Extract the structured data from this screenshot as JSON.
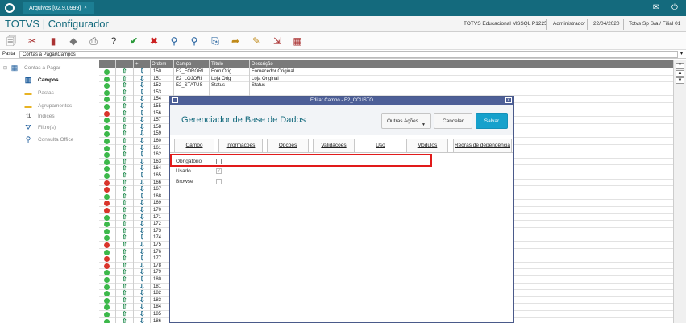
{
  "top_tab": "Arquivos [02.9.0999]",
  "app_title": "TOTVS | Configurador",
  "header_meta": {
    "env": "TOTVS Educacional MSSQL P1225",
    "user": "Administrador",
    "date": "22/04/2020",
    "branch": "Totvs Sp S/a / Filial 01"
  },
  "path": {
    "label": "Pasta",
    "value": "Contas a Pagar\\Campos"
  },
  "tree": {
    "root": "Contas a Pagar",
    "items": [
      "Campos",
      "Pastas",
      "Agrupamentos",
      "Índices",
      "Filtro(s)",
      "Consulta Office"
    ]
  },
  "grid": {
    "headers": [
      "-",
      "+",
      "Ordem",
      "Campo",
      "Título",
      "Descrição"
    ],
    "rows": [
      {
        "status": "green",
        "ordem": "150",
        "campo": "E2_FORORI",
        "titulo": "Forn.Orig.",
        "descricao": "Fornecedor Original"
      },
      {
        "status": "green",
        "ordem": "151",
        "campo": "E2_LOJORI",
        "titulo": "Loja Orig",
        "descricao": "Loja Original"
      },
      {
        "status": "green",
        "ordem": "152",
        "campo": "E2_STATUS",
        "titulo": "Status",
        "descricao": "Status"
      },
      {
        "status": "green",
        "ordem": "153",
        "campo": "",
        "titulo": "",
        "descricao": ""
      },
      {
        "status": "green",
        "ordem": "154",
        "campo": "",
        "titulo": "",
        "descricao": ""
      },
      {
        "status": "green",
        "ordem": "155",
        "campo": "",
        "titulo": "",
        "descricao": ""
      },
      {
        "status": "red",
        "ordem": "156",
        "campo": "",
        "titulo": "",
        "descricao": ""
      },
      {
        "status": "green",
        "ordem": "157",
        "campo": "",
        "titulo": "",
        "descricao": ""
      },
      {
        "status": "green",
        "ordem": "158",
        "campo": "",
        "titulo": "",
        "descricao": ""
      },
      {
        "status": "green",
        "ordem": "159",
        "campo": "",
        "titulo": "",
        "descricao": ""
      },
      {
        "status": "green",
        "ordem": "160",
        "campo": "",
        "titulo": "",
        "descricao": ""
      },
      {
        "status": "green",
        "ordem": "161",
        "campo": "",
        "titulo": "",
        "descricao": ""
      },
      {
        "status": "green",
        "ordem": "162",
        "campo": "",
        "titulo": "",
        "descricao": ""
      },
      {
        "status": "green",
        "ordem": "163",
        "campo": "",
        "titulo": "",
        "descricao": ""
      },
      {
        "status": "green",
        "ordem": "164",
        "campo": "",
        "titulo": "",
        "descricao": ""
      },
      {
        "status": "green",
        "ordem": "165",
        "campo": "",
        "titulo": "",
        "descricao": ""
      },
      {
        "status": "red",
        "ordem": "166",
        "campo": "",
        "titulo": "",
        "descricao": ""
      },
      {
        "status": "red",
        "ordem": "167",
        "campo": "",
        "titulo": "",
        "descricao": ""
      },
      {
        "status": "green",
        "ordem": "168",
        "campo": "",
        "titulo": "",
        "descricao": ""
      },
      {
        "status": "red",
        "ordem": "169",
        "campo": "",
        "titulo": "",
        "descricao": ""
      },
      {
        "status": "red",
        "ordem": "170",
        "campo": "",
        "titulo": "",
        "descricao": ""
      },
      {
        "status": "green",
        "ordem": "171",
        "campo": "",
        "titulo": "",
        "descricao": ""
      },
      {
        "status": "green",
        "ordem": "172",
        "campo": "",
        "titulo": "",
        "descricao": ""
      },
      {
        "status": "green",
        "ordem": "173",
        "campo": "",
        "titulo": "",
        "descricao": ""
      },
      {
        "status": "green",
        "ordem": "174",
        "campo": "",
        "titulo": "",
        "descricao": ""
      },
      {
        "status": "red",
        "ordem": "175",
        "campo": "",
        "titulo": "",
        "descricao": ""
      },
      {
        "status": "green",
        "ordem": "176",
        "campo": "",
        "titulo": "",
        "descricao": ""
      },
      {
        "status": "red",
        "ordem": "177",
        "campo": "",
        "titulo": "",
        "descricao": ""
      },
      {
        "status": "red",
        "ordem": "178",
        "campo": "",
        "titulo": "",
        "descricao": ""
      },
      {
        "status": "green",
        "ordem": "179",
        "campo": "",
        "titulo": "",
        "descricao": ""
      },
      {
        "status": "green",
        "ordem": "180",
        "campo": "",
        "titulo": "",
        "descricao": ""
      },
      {
        "status": "green",
        "ordem": "181",
        "campo": "",
        "titulo": "",
        "descricao": ""
      },
      {
        "status": "green",
        "ordem": "182",
        "campo": "",
        "titulo": "",
        "descricao": ""
      },
      {
        "status": "green",
        "ordem": "183",
        "campo": "",
        "titulo": "",
        "descricao": ""
      },
      {
        "status": "green",
        "ordem": "184",
        "campo": "",
        "titulo": "",
        "descricao": ""
      },
      {
        "status": "green",
        "ordem": "185",
        "campo": "",
        "titulo": "",
        "descricao": ""
      },
      {
        "status": "green",
        "ordem": "186",
        "campo": "",
        "titulo": "",
        "descricao": ""
      }
    ]
  },
  "modal": {
    "title": "Editar Campo - E2_CCUSTO",
    "heading": "Gerenciador de Base de Dados",
    "btn_more": "Outras Ações",
    "btn_cancel": "Cancelar",
    "btn_save": "Salvar",
    "tabs": [
      "Campo",
      "Informações",
      "Opções",
      "Validações",
      "Uso",
      "Módulos",
      "Regras de dependência"
    ],
    "active_tab": "Uso",
    "fields": [
      {
        "label": "Obrigatório",
        "checked": false
      },
      {
        "label": "Usado",
        "checked": true
      },
      {
        "label": "Browse",
        "checked": false
      }
    ]
  },
  "colors": {
    "brand": "#146a7d",
    "modal_title": "#4d5f97",
    "primary": "#16a1cc",
    "highlight": "#e11a1a",
    "ok": "#3cb84a",
    "error": "#d9342b"
  }
}
